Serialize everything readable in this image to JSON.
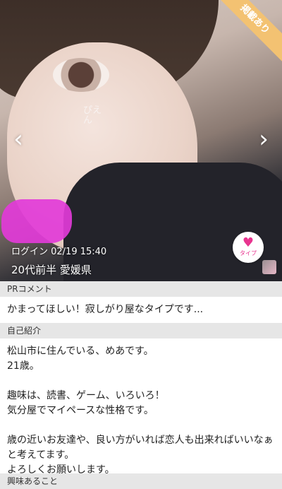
{
  "hero": {
    "badge": "掲載あり",
    "sticker_text": "ぴえん",
    "login_text": "ログイン  02/19 15:40",
    "profile_text": "20代前半  愛媛県",
    "like_label": "タイプ",
    "arrow_left": "‹",
    "arrow_right": "›",
    "heart": "♥"
  },
  "pr": {
    "header": "PRコメント",
    "text": "かまってほしい！寂しがり屋なタイプです..."
  },
  "intro": {
    "header": "自己紹介",
    "text": "松山市に住んでいる、めあです。\n21歳。\n\n趣味は、読書、ゲーム、いろいろ！\n気分屋でマイペースな性格です。\n\n歳の近いお友達や、良い方がいれば恋人も出来ればいいなぁと考えてます。\nよろしくお願いします。"
  },
  "next_section": {
    "header": "興味あること"
  }
}
